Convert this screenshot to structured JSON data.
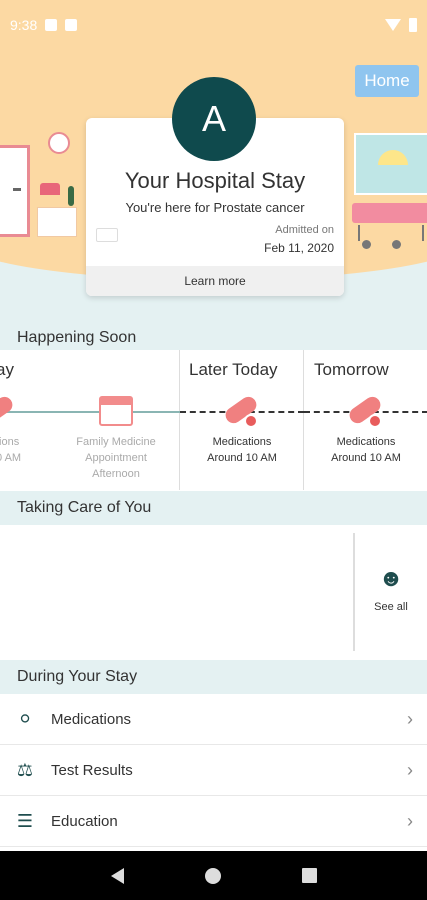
{
  "status_bar": {
    "time": "9:38"
  },
  "header": {
    "home_label": "Home",
    "avatar_letter": "A",
    "card_title": "Your Hospital Stay",
    "card_subtitle": "You're here for Prostate cancer",
    "admitted_label": "Admitted on",
    "admitted_date": "Feb 11, 2020",
    "learn_more": "Learn more"
  },
  "happening_soon": {
    "title": "Happening Soon",
    "columns": [
      {
        "heading": "ay",
        "events": [
          {
            "line1": "tions",
            "line2": "0 AM"
          },
          {
            "line1": "Family Medicine",
            "line2": "Appointment",
            "line3": "Afternoon"
          }
        ]
      },
      {
        "heading": "Later Today",
        "events": [
          {
            "line1": "Medications",
            "line2": "Around 10 AM"
          }
        ]
      },
      {
        "heading": "Tomorrow",
        "events": [
          {
            "line1": "Medications",
            "line2": "Around 10 AM"
          }
        ]
      }
    ]
  },
  "taking_care": {
    "title": "Taking Care of You",
    "see_all": "See all"
  },
  "during_stay": {
    "title": "During Your Stay",
    "items": [
      {
        "label": "Medications",
        "icon": "pill-icon"
      },
      {
        "label": "Test Results",
        "icon": "flask-icon"
      },
      {
        "label": "Education",
        "icon": "book-icon"
      }
    ]
  },
  "colors": {
    "accent": "#0f4a4d",
    "header_bg": "#fcd9a3",
    "section_bg": "#e4f1f2",
    "home_button": "#8fc5ef",
    "pill": "#f08080"
  }
}
